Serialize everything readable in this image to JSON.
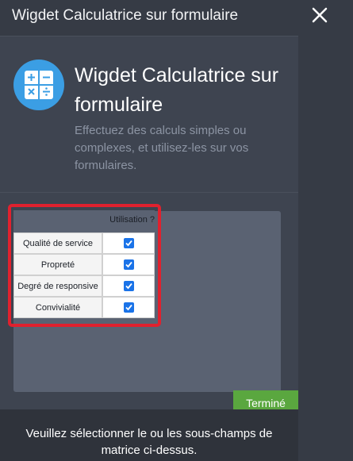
{
  "header": {
    "title": "Wigdet Calculatrice sur formulaire"
  },
  "widget": {
    "title": "Wigdet Calculatrice sur formulaire",
    "description": "Effectuez des calculs simples ou complexes, et utilisez-les sur vos formulaires.",
    "icon": "calculator-icon",
    "icon_color": "#3b9ee4"
  },
  "matrix": {
    "column_header": "Utilisation ?",
    "rows": [
      {
        "label": "Qualité de service",
        "checked": true
      },
      {
        "label": "Propreté",
        "checked": true
      },
      {
        "label": "Degré de responsive",
        "checked": true
      },
      {
        "label": "Convivialité",
        "checked": true
      }
    ],
    "highlight_color": "#e0212e"
  },
  "done_button": {
    "label": "Terminé",
    "color": "#5aa73f"
  },
  "tooltip": {
    "text": "Veuillez sélectionner le ou les sous-champs de matrice ci-dessus."
  }
}
